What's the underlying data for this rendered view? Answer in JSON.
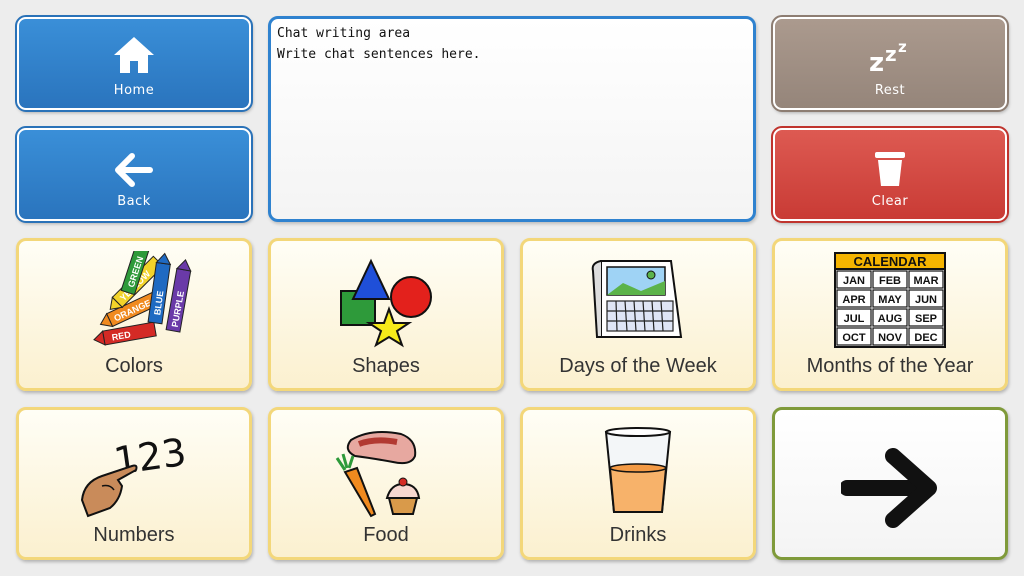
{
  "controls": {
    "home": {
      "label": "Home",
      "icon": "home-icon"
    },
    "back": {
      "label": "Back",
      "icon": "arrow-left-icon"
    },
    "rest": {
      "label": "Rest",
      "icon": "sleep-zzz-icon"
    },
    "clear": {
      "label": "Clear",
      "icon": "trash-icon"
    }
  },
  "chat": {
    "title": "Chat writing area",
    "placeholder": "Write chat sentences here."
  },
  "categories": [
    {
      "label": "Colors",
      "icon": "crayons-icon"
    },
    {
      "label": "Shapes",
      "icon": "shapes-icon"
    },
    {
      "label": "Days of the Week",
      "icon": "calendar-page-icon"
    },
    {
      "label": "Months of the Year",
      "icon": "months-calendar-icon"
    },
    {
      "label": "Numbers",
      "icon": "counting-hand-icon"
    },
    {
      "label": "Food",
      "icon": "food-icon"
    },
    {
      "label": "Drinks",
      "icon": "drink-glass-icon"
    }
  ],
  "crayon_words": [
    "RED",
    "ORANGE",
    "YELLOW",
    "GREEN",
    "BLUE",
    "PURPLE"
  ],
  "numbers_text": "123",
  "calendar": {
    "header": "CALENDAR",
    "months": [
      "JAN",
      "FEB",
      "MAR",
      "APR",
      "MAY",
      "JUN",
      "JUL",
      "AUG",
      "SEP",
      "OCT",
      "NOV",
      "DEC"
    ]
  },
  "colors": {
    "blue": "#2a74bd",
    "brown": "#95857a",
    "red": "#c93b35",
    "yellow_border": "#f3d77a",
    "next_border": "#7f9a3a"
  },
  "next": {
    "icon": "arrow-right-icon"
  }
}
